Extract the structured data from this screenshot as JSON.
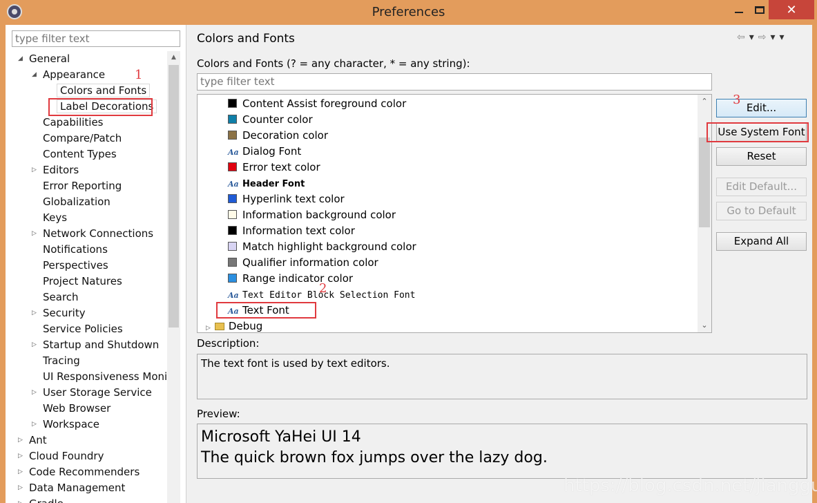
{
  "window": {
    "title": "Preferences",
    "close_symbol": "✕",
    "accent": "#e39c5c"
  },
  "left": {
    "filter_placeholder": "type filter text",
    "tree": [
      {
        "label": "General",
        "level": 1,
        "arrow": "expanded"
      },
      {
        "label": "Appearance",
        "level": 2,
        "arrow": "expanded"
      },
      {
        "label": "Colors and Fonts",
        "level": 3,
        "arrow": "none",
        "selected": true
      },
      {
        "label": "Label Decorations",
        "level": 3,
        "arrow": "none"
      },
      {
        "label": "Capabilities",
        "level": 2,
        "arrow": "none"
      },
      {
        "label": "Compare/Patch",
        "level": 2,
        "arrow": "none"
      },
      {
        "label": "Content Types",
        "level": 2,
        "arrow": "none"
      },
      {
        "label": "Editors",
        "level": 2,
        "arrow": "collapsed"
      },
      {
        "label": "Error Reporting",
        "level": 2,
        "arrow": "none"
      },
      {
        "label": "Globalization",
        "level": 2,
        "arrow": "none"
      },
      {
        "label": "Keys",
        "level": 2,
        "arrow": "none"
      },
      {
        "label": "Network Connections",
        "level": 2,
        "arrow": "collapsed"
      },
      {
        "label": "Notifications",
        "level": 2,
        "arrow": "none"
      },
      {
        "label": "Perspectives",
        "level": 2,
        "arrow": "none"
      },
      {
        "label": "Project Natures",
        "level": 2,
        "arrow": "none"
      },
      {
        "label": "Search",
        "level": 2,
        "arrow": "none"
      },
      {
        "label": "Security",
        "level": 2,
        "arrow": "collapsed"
      },
      {
        "label": "Service Policies",
        "level": 2,
        "arrow": "none"
      },
      {
        "label": "Startup and Shutdown",
        "level": 2,
        "arrow": "collapsed"
      },
      {
        "label": "Tracing",
        "level": 2,
        "arrow": "none"
      },
      {
        "label": "UI Responsiveness Monit",
        "level": 2,
        "arrow": "none"
      },
      {
        "label": "User Storage Service",
        "level": 2,
        "arrow": "collapsed"
      },
      {
        "label": "Web Browser",
        "level": 2,
        "arrow": "none"
      },
      {
        "label": "Workspace",
        "level": 2,
        "arrow": "collapsed"
      },
      {
        "label": "Ant",
        "level": 1,
        "arrow": "collapsed"
      },
      {
        "label": "Cloud Foundry",
        "level": 1,
        "arrow": "collapsed"
      },
      {
        "label": "Code Recommenders",
        "level": 1,
        "arrow": "collapsed"
      },
      {
        "label": "Data Management",
        "level": 1,
        "arrow": "collapsed"
      },
      {
        "label": "Gradle",
        "level": 1,
        "arrow": "collapsed"
      }
    ]
  },
  "right": {
    "title": "Colors and Fonts",
    "nav": {
      "back": "⇦",
      "drop1": "▾",
      "forward": "⇨",
      "drop2": "▾",
      "menu": "▾"
    },
    "list_label": "Colors and Fonts (? = any character, * = any string):",
    "filter_placeholder": "type filter text",
    "items": [
      {
        "label": "Content Assist foreground color",
        "kind": "color",
        "color": "#000000"
      },
      {
        "label": "Counter color",
        "kind": "color",
        "color": "#0f7fa8"
      },
      {
        "label": "Decoration color",
        "kind": "color",
        "color": "#8b7246"
      },
      {
        "label": "Dialog Font",
        "kind": "font",
        "font": "normal"
      },
      {
        "label": "Error text color",
        "kind": "color",
        "color": "#e0000f"
      },
      {
        "label": "Header Font",
        "kind": "font",
        "font": "bold"
      },
      {
        "label": "Hyperlink text color",
        "kind": "color",
        "color": "#1f5bd6"
      },
      {
        "label": "Information background color",
        "kind": "color",
        "color": "#fffbe8"
      },
      {
        "label": "Information text color",
        "kind": "color",
        "color": "#000000"
      },
      {
        "label": "Match highlight background color",
        "kind": "color",
        "color": "#d8d4f3"
      },
      {
        "label": "Qualifier information color",
        "kind": "color",
        "color": "#777777"
      },
      {
        "label": "Range indicator color",
        "kind": "color",
        "color": "#2b8fe0"
      },
      {
        "label": "Text Editor Block Selection Font",
        "kind": "font",
        "font": "mono"
      },
      {
        "label": "Text Font",
        "kind": "font",
        "font": "normal",
        "selected": true
      },
      {
        "label": "Debug",
        "kind": "category"
      }
    ],
    "glyph": "Aa",
    "buttons": {
      "edit": "Edit...",
      "use_system_font": "Use System Font",
      "reset": "Reset",
      "edit_default": "Edit Default...",
      "go_to_default": "Go to Default",
      "expand_all": "Expand All"
    },
    "description_label": "Description:",
    "description": "The text font is used by text editors.",
    "preview_label": "Preview:",
    "preview_font": "Microsoft YaHei UI 14",
    "preview_text": "The quick brown fox jumps over the lazy dog."
  },
  "annotations": {
    "one": "1",
    "two": "2",
    "three": "3",
    "color": "#e0393e"
  },
  "watermark": "https://blog.csdn.net/jianggujin"
}
